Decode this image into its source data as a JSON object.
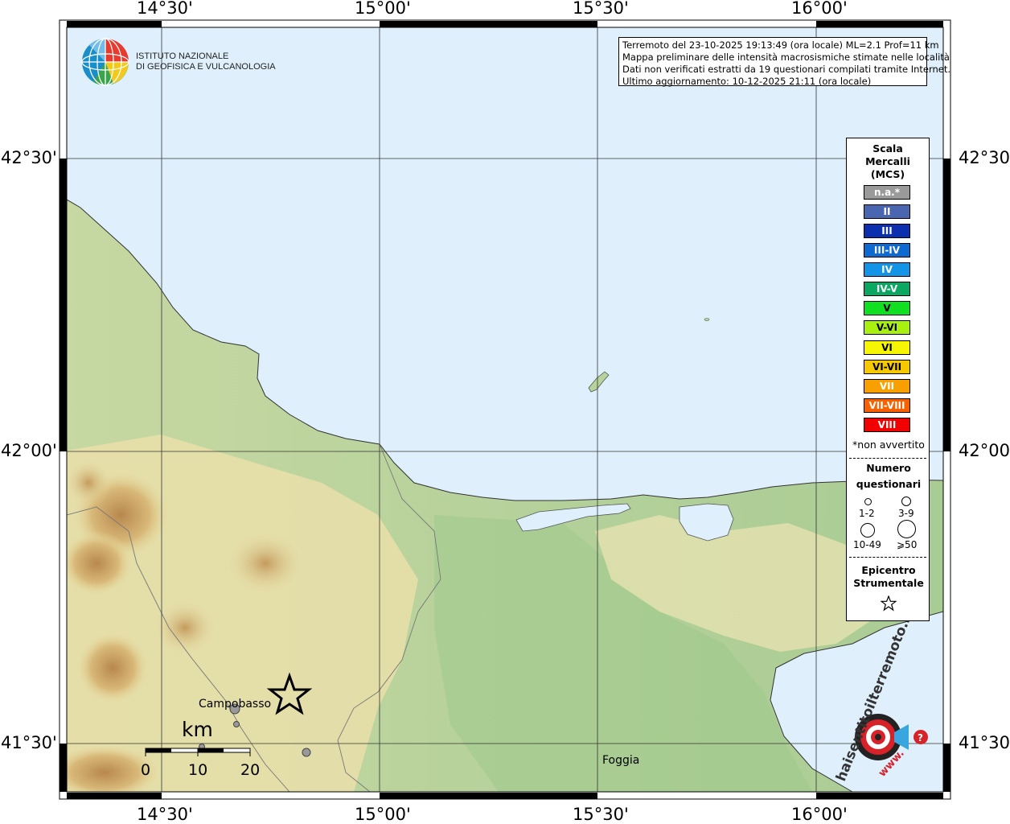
{
  "header": {
    "line1": "Terremoto del 23-10-2025 19:13:49 (ora locale) ML=2.1 Prof=11 km",
    "line2": "Mappa preliminare delle intensità macrosismiche stimate nelle località",
    "line3": "Dati non verificati estratti da 19 questionari compilati tramite Internet.",
    "line4": "Ultimo aggiornamento: 10-12-2025 21:11 (ora locale)"
  },
  "logo": {
    "line1": "ISTITUTO NAZIONALE",
    "line2": "DI GEOFISICA E VULCANOLOGIA"
  },
  "axes": {
    "lon_labels": [
      "14°30'",
      "15°00'",
      "15°30'",
      "16°00'"
    ],
    "lat_labels": [
      "42°30'",
      "42°00'",
      "41°30'"
    ]
  },
  "legend": {
    "title": [
      "Scala",
      "Mercalli",
      "(MCS)"
    ],
    "classes": [
      {
        "label": "n.a.*",
        "color": "#9a9a9a"
      },
      {
        "label": "II",
        "color": "#4a66b0"
      },
      {
        "label": "III",
        "color": "#0c2fb0"
      },
      {
        "label": "III-IV",
        "color": "#0e6ad0"
      },
      {
        "label": "IV",
        "color": "#1494e6"
      },
      {
        "label": "IV-V",
        "color": "#0aa860"
      },
      {
        "label": "V",
        "color": "#10e020"
      },
      {
        "label": "V-VI",
        "color": "#a8f010"
      },
      {
        "label": "VI",
        "color": "#f6f600"
      },
      {
        "label": "VI-VII",
        "color": "#f6c800"
      },
      {
        "label": "VII",
        "color": "#f8a000"
      },
      {
        "label": "VII-VIII",
        "color": "#f86000"
      },
      {
        "label": "VIII",
        "color": "#f00000"
      }
    ],
    "note": "*non avvertito",
    "count_title_1": "Numero",
    "count_title_2": "questionari",
    "count_1": "1-2",
    "count_2": "3-9",
    "count_3": "10-49",
    "count_4": "⩾50",
    "epic_1": "Epicentro",
    "epic_2": "Strumentale"
  },
  "places": {
    "campobasso": "Campobasso",
    "foggia": "Foggia"
  },
  "scalebar": {
    "unit": "km",
    "ticks": [
      "0",
      "10",
      "20"
    ]
  },
  "hst_logo": {
    "text": "haisentitoilterremoto.it",
    "www": "www."
  }
}
